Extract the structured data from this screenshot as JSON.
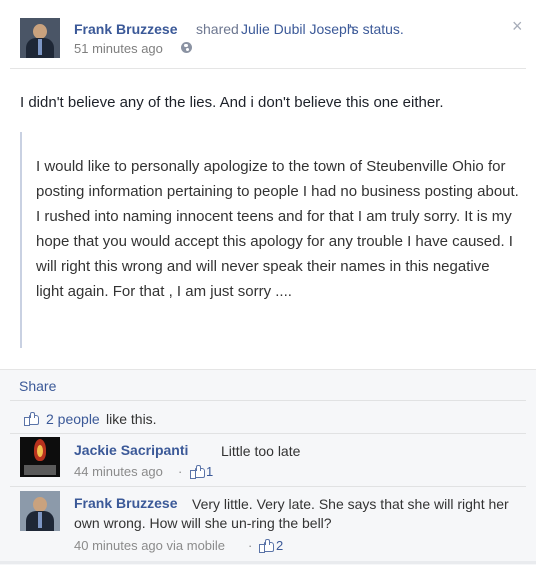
{
  "post": {
    "author": "Frank Bruzzese",
    "shared_text": "shared",
    "shared_link": "Julie Dubil Joseph",
    "shared_suffix": "'s status.",
    "timestamp": "51 minutes ago",
    "status": "I didn't believe any of the lies. And i don't believe this one either.",
    "quote": "I would like to personally apologize to the town of Steubenville Ohio for posting information pertaining to people I had no business posting about. I rushed into naming innocent teens and for that I am truly sorry. It is my hope that you would accept this apology for any trouble I have caused. I will right this wrong and will never speak their names in this negative light again. For that , I am just sorry ...."
  },
  "icons": {
    "close": "×",
    "close_name": "close-icon",
    "globe_name": "globe-icon",
    "like_name": "like-icon"
  },
  "ufi": {
    "share_label": "Share",
    "likes_count": "2 people",
    "likes_suffix": "like this."
  },
  "comments": [
    {
      "author": "Jackie Sacripanti",
      "text": "Little too late",
      "time": "44 minutes ago",
      "separator": "·",
      "likes": "1"
    },
    {
      "author": "Frank Bruzzese",
      "text": "Very little. Very late. She says that she will right her own wrong. How will she un-ring the bell?",
      "time": "40 minutes ago via mobile",
      "separator": "·",
      "likes": "2"
    }
  ],
  "colors": {
    "link": "#3b5998",
    "ufi_background": "#f6f7f9",
    "quote_border": "#c9d1e2"
  }
}
